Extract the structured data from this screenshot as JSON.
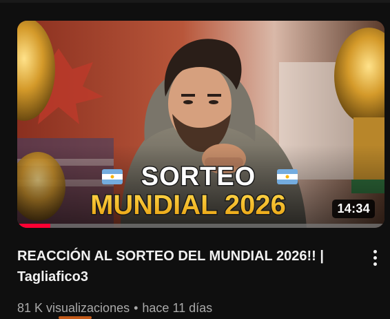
{
  "video": {
    "thumbnail": {
      "headline_top": "SORTEO",
      "headline_bottom": "MUNDIAL 2026",
      "duration": "14:34",
      "watched_fraction": 0.09
    },
    "title": "REACCIÓN AL SORTEO DEL MUNDIAL 2026!! | Tagliafico3",
    "views": "81 K visualizaciones",
    "separator": "•",
    "age": "hace 11 días"
  },
  "icons": {
    "menu": "more-vert-icon",
    "flag": "argentina-flag-icon"
  },
  "colors": {
    "background": "#0f0f0f",
    "title_text": "#f1f1f1",
    "meta_text": "#aaaaaa",
    "progress": "#ff0033",
    "headline_white": "#ffffff",
    "headline_gold": "#f5b820"
  }
}
